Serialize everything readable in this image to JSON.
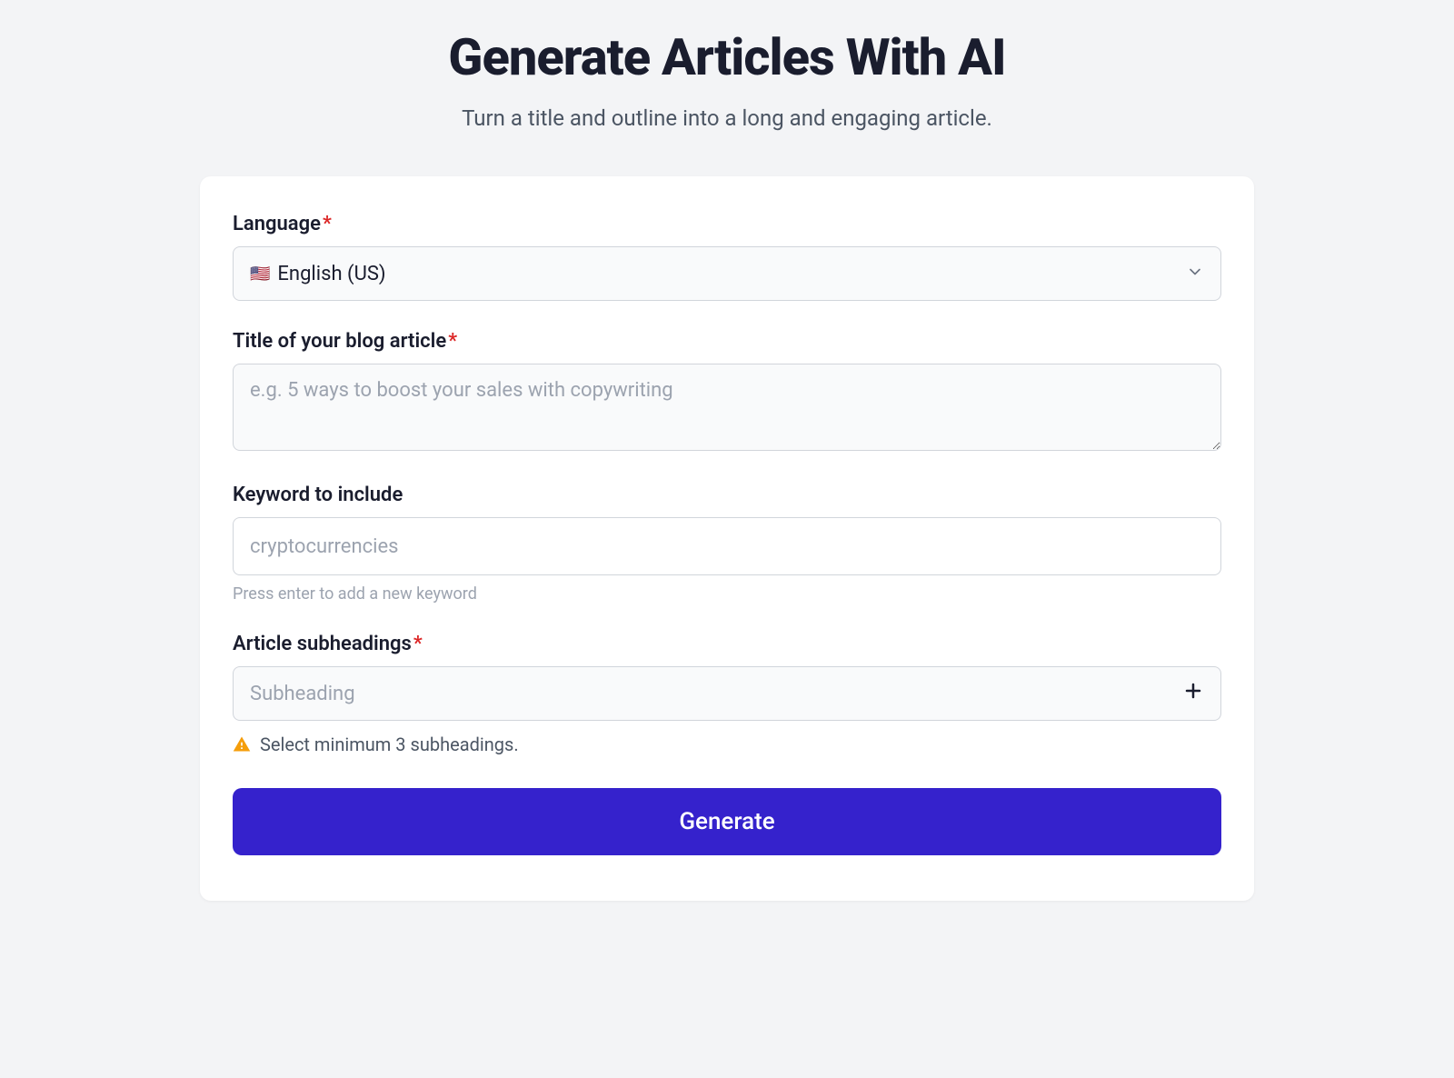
{
  "header": {
    "title": "Generate Articles With AI",
    "subtitle": "Turn a title and outline into a long and engaging article."
  },
  "form": {
    "language": {
      "label": "Language",
      "required": "*",
      "flag": "🇺🇸",
      "value": "English (US)"
    },
    "title": {
      "label": "Title of your blog article",
      "required": "*",
      "placeholder": "e.g. 5 ways to boost your sales with copywriting",
      "value": ""
    },
    "keyword": {
      "label": "Keyword to include",
      "placeholder": "cryptocurrencies",
      "value": "",
      "hint": "Press enter to add a new keyword"
    },
    "subheadings": {
      "label": "Article subheadings",
      "required": "*",
      "placeholder": "Subheading",
      "warning": "Select minimum 3 subheadings."
    },
    "submit": {
      "label": "Generate"
    }
  }
}
